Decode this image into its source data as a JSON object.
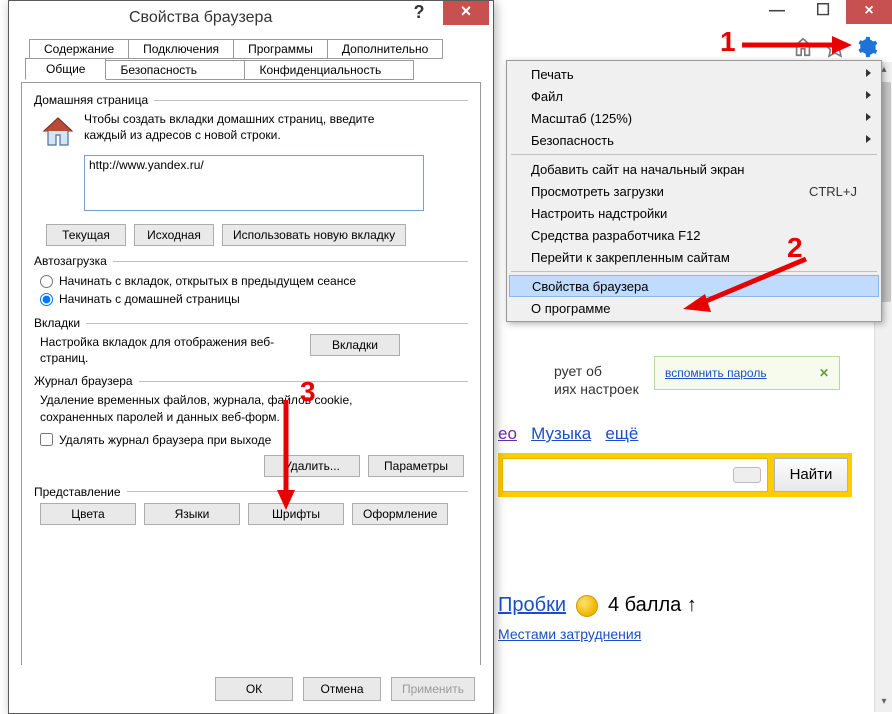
{
  "dialog": {
    "title": "Свойства браузера",
    "help_char": "?",
    "close_char": "×",
    "tabs_row1": [
      "Содержание",
      "Подключения",
      "Программы",
      "Дополнительно"
    ],
    "tabs_row2": [
      "Общие",
      "Безопасность",
      "Конфиденциальность"
    ],
    "active_tab": "Общие",
    "homepage": {
      "group_label": "Домашняя страница",
      "desc": "Чтобы создать вкладки домашних страниц, введите каждый из адресов с новой строки.",
      "value": "http://www.yandex.ru/",
      "btn_current": "Текущая",
      "btn_default": "Исходная",
      "btn_newtab": "Использовать новую вкладку"
    },
    "startup": {
      "group_label": "Автозагрузка",
      "opt_last": "Начинать с вкладок, открытых в предыдущем сеансе",
      "opt_home": "Начинать с домашней страницы"
    },
    "tabs_section": {
      "group_label": "Вкладки",
      "desc": "Настройка вкладок для отображения веб-страниц.",
      "btn": "Вкладки"
    },
    "history": {
      "group_label": "Журнал браузера",
      "desc": "Удаление временных файлов, журнала, файлов cookie, сохраненных паролей и данных веб-форм.",
      "chk_on_exit": "Удалять журнал браузера при выходе",
      "btn_delete": "Удалить...",
      "btn_settings": "Параметры"
    },
    "appearance": {
      "group_label": "Представление",
      "btn_colors": "Цвета",
      "btn_langs": "Языки",
      "btn_fonts": "Шрифты",
      "btn_access": "Оформление"
    },
    "footer": {
      "ok": "ОК",
      "cancel": "Отмена",
      "apply": "Применить"
    }
  },
  "window_buttons": {
    "min": "—",
    "max": "☐",
    "close": "×"
  },
  "menu": {
    "items": [
      {
        "label": "Печать",
        "submenu": true
      },
      {
        "label": "Файл",
        "submenu": true
      },
      {
        "label": "Масштаб (125%)",
        "submenu": true
      },
      {
        "label": "Безопасность",
        "submenu": true
      },
      {
        "sep": true
      },
      {
        "label": "Добавить сайт на начальный экран"
      },
      {
        "label": "Просмотреть загрузки",
        "shortcut": "CTRL+J"
      },
      {
        "label": "Настроить надстройки"
      },
      {
        "label": "Средства разработчика F12"
      },
      {
        "label": "Перейти к закрепленным сайтам"
      },
      {
        "sep": true
      },
      {
        "label": "Свойства браузера",
        "highlighted": true
      },
      {
        "label": "О программе"
      }
    ]
  },
  "page": {
    "remember_text": "вспомнить пароль",
    "text_under1": "рует об",
    "text_under2": "иях настроек",
    "nav_video": "ео",
    "nav_music": "Музыка",
    "nav_more": "ещё",
    "search_btn": "Найти",
    "traffic_label": "Пробки",
    "traffic_score": "4 балла ↑",
    "traffic_sub": "Местами затруднения"
  },
  "annotations": {
    "n1": "1",
    "n2": "2",
    "n3": "3"
  }
}
